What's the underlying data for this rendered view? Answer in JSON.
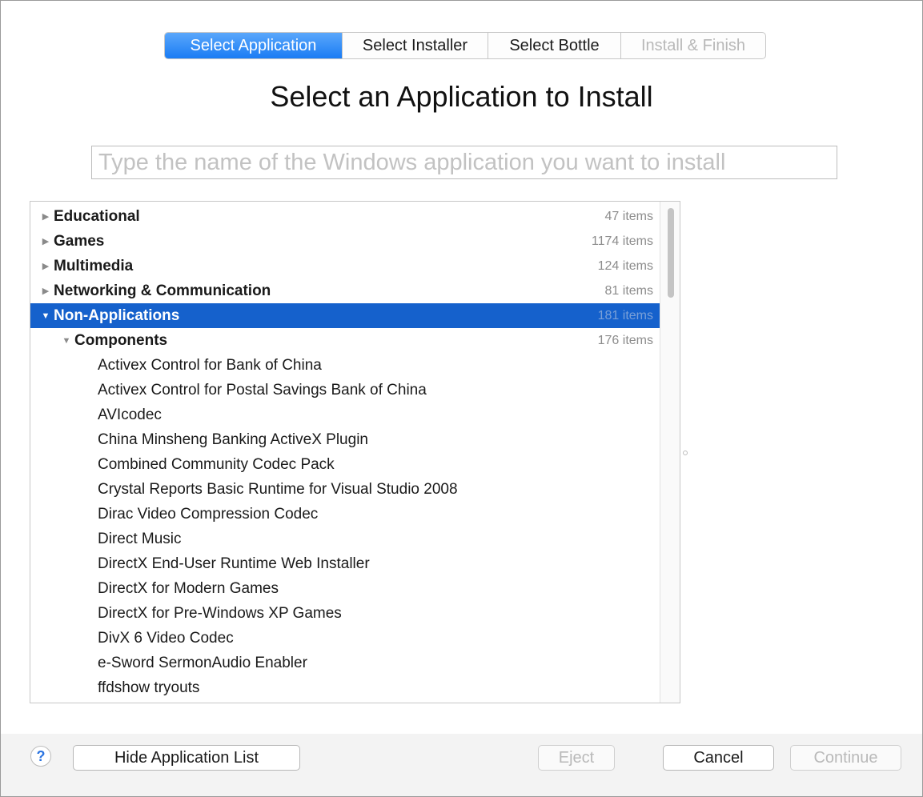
{
  "steps": [
    {
      "label": "Select Application",
      "state": "active"
    },
    {
      "label": "Select Installer",
      "state": "normal"
    },
    {
      "label": "Select Bottle",
      "state": "normal"
    },
    {
      "label": "Install & Finish",
      "state": "disabled"
    }
  ],
  "title": "Select an Application to Install",
  "search": {
    "placeholder": "Type the name of the Windows application you want to install",
    "value": ""
  },
  "list": {
    "categories": [
      {
        "label": "Educational",
        "count": "47 items",
        "expanded": false
      },
      {
        "label": "Games",
        "count": "1174 items",
        "expanded": false
      },
      {
        "label": "Multimedia",
        "count": "124 items",
        "expanded": false
      },
      {
        "label": "Networking & Communication",
        "count": "81 items",
        "expanded": false
      },
      {
        "label": "Non-Applications",
        "count": "181 items",
        "expanded": true,
        "selected": true
      }
    ],
    "subcategory": {
      "label": "Components",
      "count": "176 items",
      "expanded": true
    },
    "items": [
      "Activex Control for Bank of China",
      "Activex Control for Postal Savings Bank of China",
      "AVIcodec",
      "China Minsheng Banking ActiveX Plugin",
      "Combined Community Codec Pack",
      "Crystal Reports Basic Runtime for Visual Studio 2008",
      "Dirac Video Compression Codec",
      "Direct Music",
      "DirectX End-User Runtime Web Installer",
      "DirectX for Modern Games",
      "DirectX for Pre-Windows XP Games",
      "DivX 6 Video Codec",
      "e-Sword SermonAudio Enabler",
      "ffdshow tryouts"
    ]
  },
  "footer": {
    "help": "?",
    "hide_list": "Hide Application List",
    "eject": "Eject",
    "cancel": "Cancel",
    "continue": "Continue"
  },
  "colors": {
    "accent": "#1a7cf4",
    "selection": "#1561cc"
  }
}
